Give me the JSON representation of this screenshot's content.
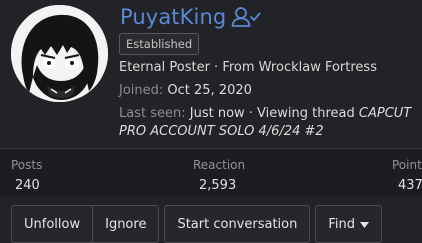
{
  "profile": {
    "username": "PuyatKing",
    "badge": "Established",
    "title_line": "Eternal Poster · From Wrocklaw Fortress",
    "joined_label": "Joined:",
    "joined_value": "Oct 25, 2020",
    "last_seen_label": "Last seen:",
    "last_seen_value": "Just now · Viewing thread",
    "thread_title_part1": "CAPCUT",
    "thread_title_part2": "PRO ACCOUNT SOLO 4/6/24 #2",
    "icons": {
      "user_status": "user-check-icon",
      "find_caret": "caret-down-icon"
    },
    "colors": {
      "username": "#5a88d8",
      "background": "#222326"
    }
  },
  "stats": {
    "posts_label": "Posts",
    "posts_value": "240",
    "reaction_label": "Reaction",
    "reaction_value": "2,593",
    "points_label": "Points",
    "points_value": "437"
  },
  "actions": {
    "unfollow": "Unfollow",
    "ignore": "Ignore",
    "start_conversation": "Start conversation",
    "find": "Find"
  }
}
